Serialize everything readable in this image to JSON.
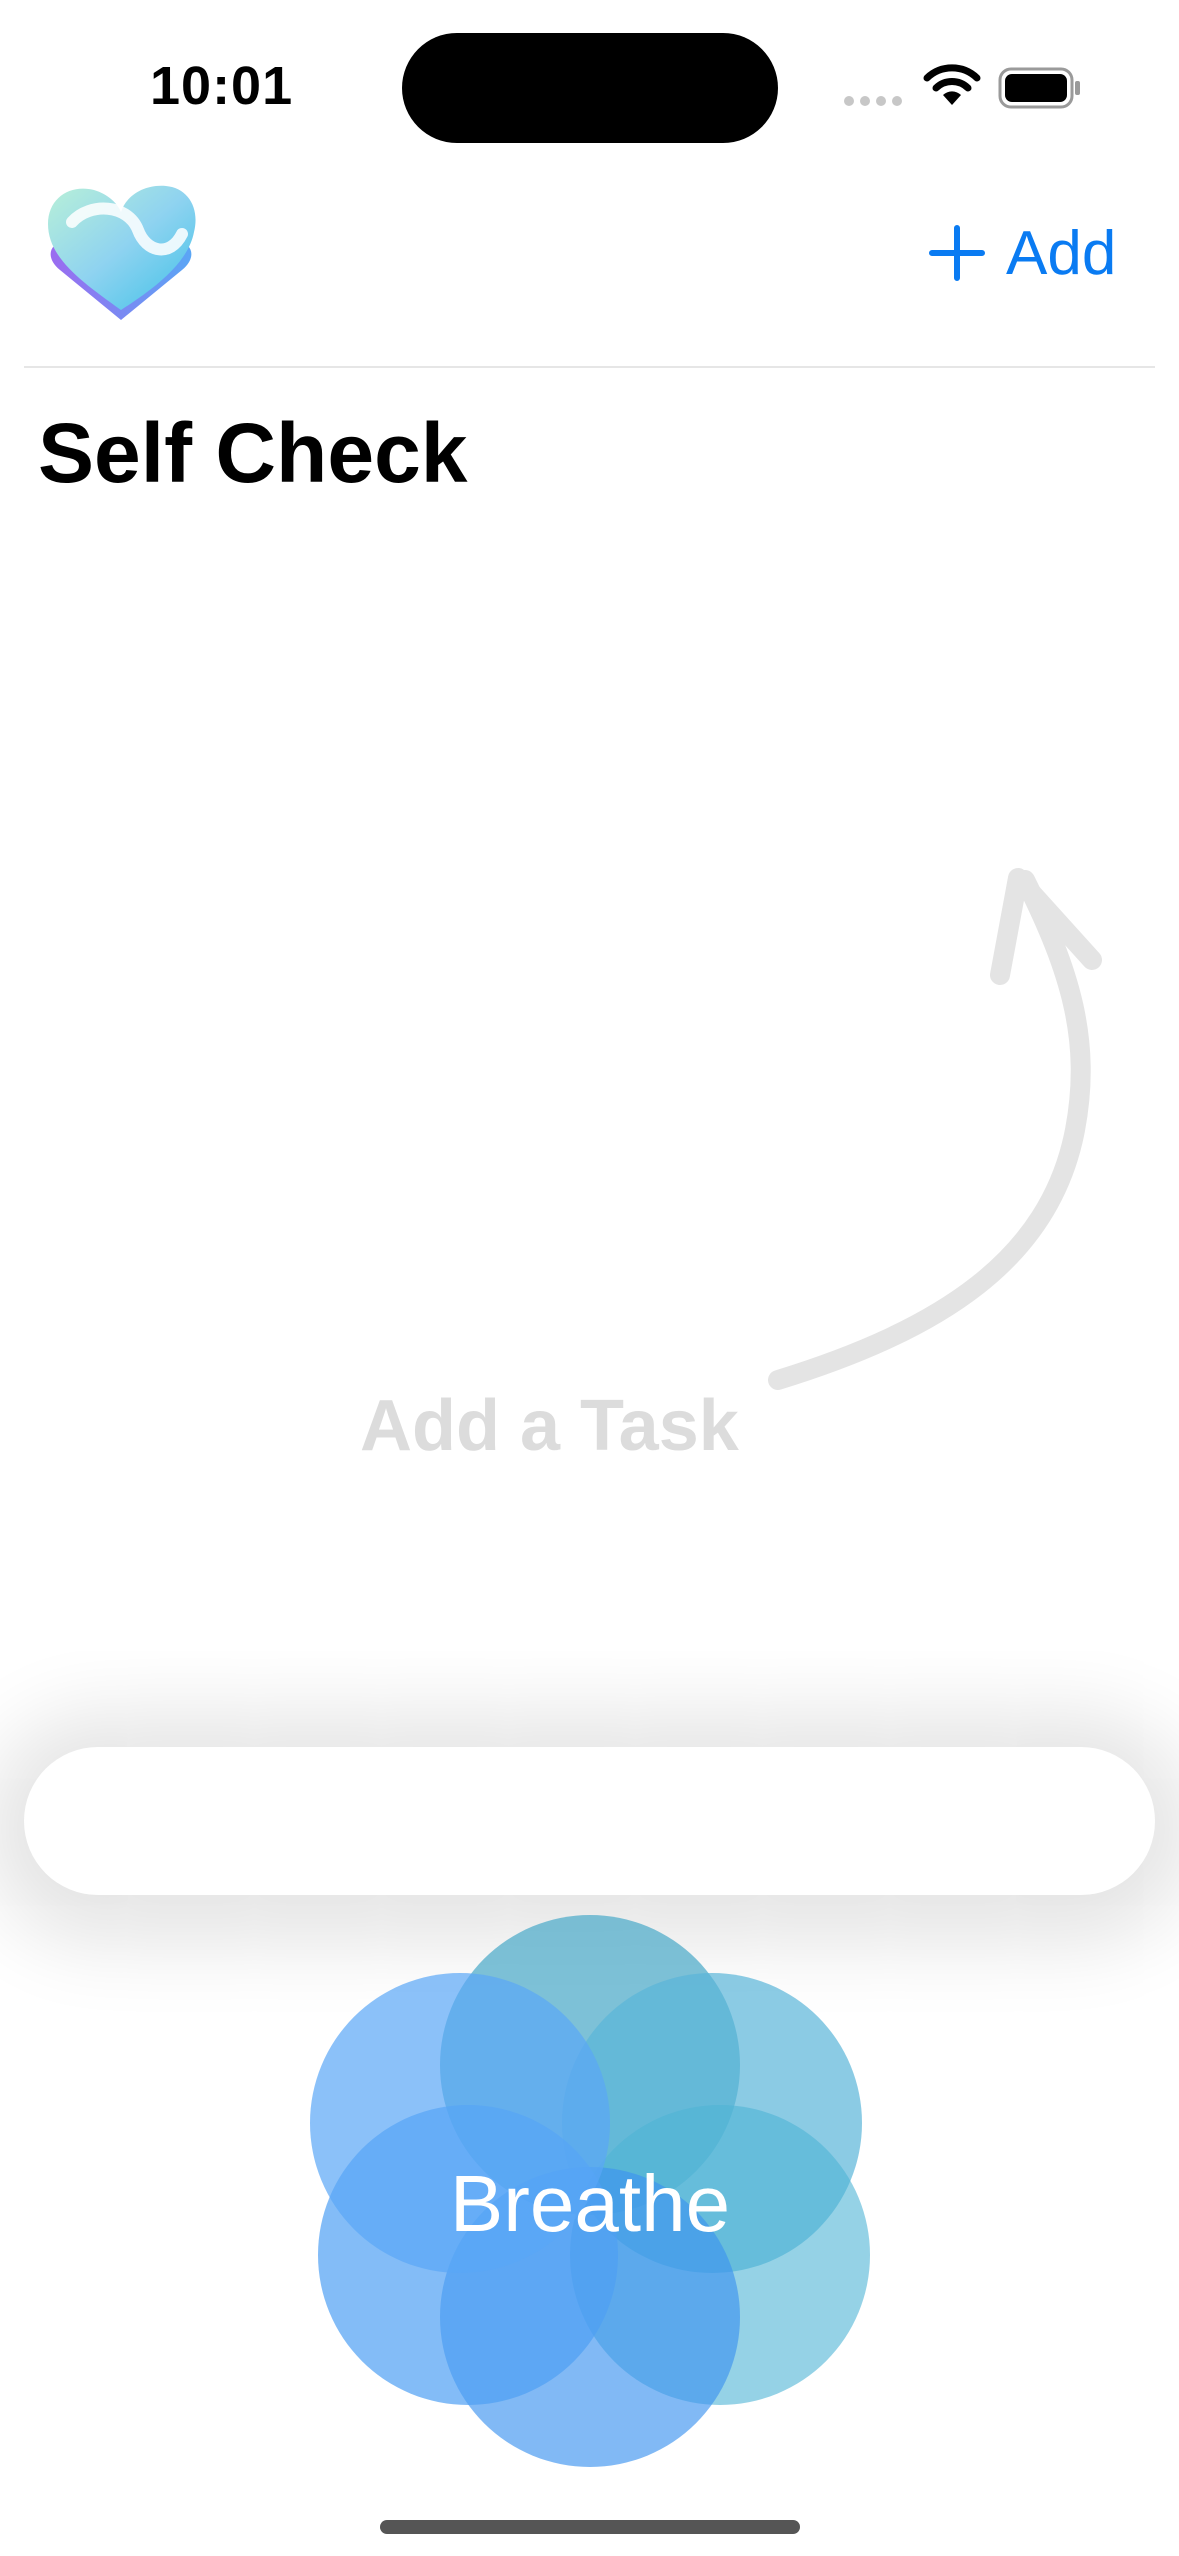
{
  "status_bar": {
    "time": "10:01",
    "icons": [
      "signal-icon",
      "wifi-icon",
      "battery-icon"
    ]
  },
  "nav_bar": {
    "logo": "heart-logo",
    "add_label": "Add",
    "add_icon": "plus-icon"
  },
  "page": {
    "title": "Self Check"
  },
  "empty_state": {
    "hint": "Add a Task",
    "arrow_icon": "curved-arrow-icon"
  },
  "task_input": {
    "value": ""
  },
  "breathe_button": {
    "label": "Breathe"
  },
  "colors": {
    "accent": "#0a7bf2",
    "hint_text": "#dcdcdc",
    "breathe_blue": "#2a8cf4",
    "breathe_teal": "#45a8c8"
  }
}
